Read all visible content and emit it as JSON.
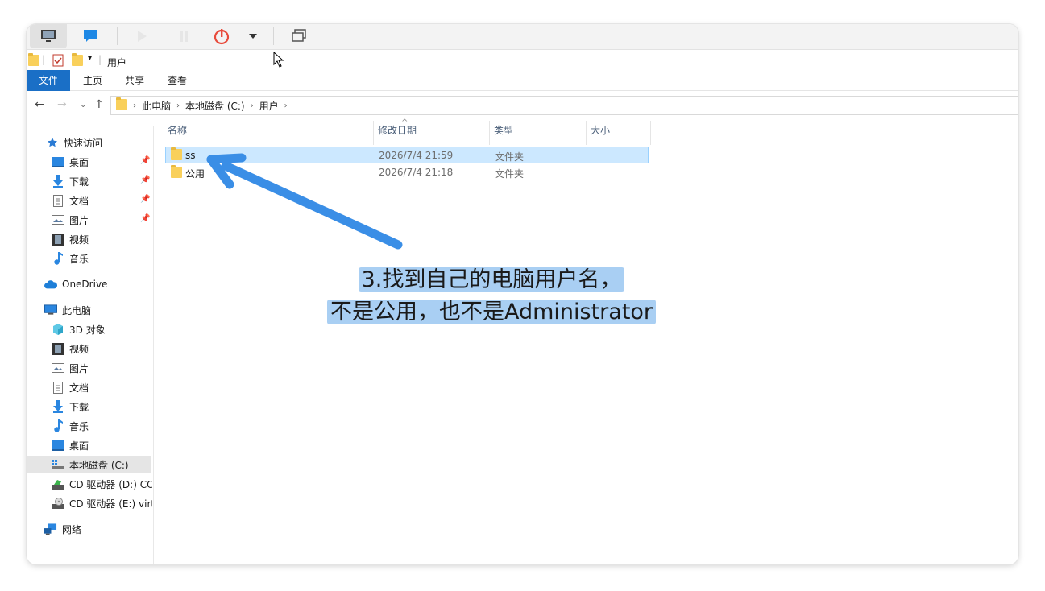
{
  "window_title": "用户",
  "ribbon": {
    "tabs": [
      "文件",
      "主页",
      "共享",
      "查看"
    ]
  },
  "address": {
    "crumbs": [
      "此电脑",
      "本地磁盘 (C:)",
      "用户"
    ]
  },
  "sidebar": {
    "quick_access": "快速访问",
    "quick_items": [
      "桌面",
      "下载",
      "文档",
      "图片",
      "视频",
      "音乐"
    ],
    "onedrive": "OneDrive",
    "this_pc": "此电脑",
    "pc_items": [
      "3D 对象",
      "视频",
      "图片",
      "文档",
      "下载",
      "音乐",
      "桌面",
      "本地磁盘 (C:)",
      "CD 驱动器 (D:) CCC",
      "CD 驱动器 (E:) virti"
    ],
    "network": "网络"
  },
  "columns": [
    "名称",
    "修改日期",
    "类型",
    "大小"
  ],
  "files": [
    {
      "name": "ss",
      "date": "2026/7/4 21:59",
      "type": "文件夹",
      "size": ""
    },
    {
      "name": "公用",
      "date": "2026/7/4 21:18",
      "type": "文件夹",
      "size": ""
    }
  ],
  "annotation": {
    "line1": "3.找到自己的电脑用户名，",
    "line2": "不是公用，也不是Administrator"
  },
  "colors": {
    "accent": "#1a6fc6",
    "arrow": "#3a8ee6",
    "selection": "#cce8ff",
    "annotation_bg": "#a9cff3"
  }
}
